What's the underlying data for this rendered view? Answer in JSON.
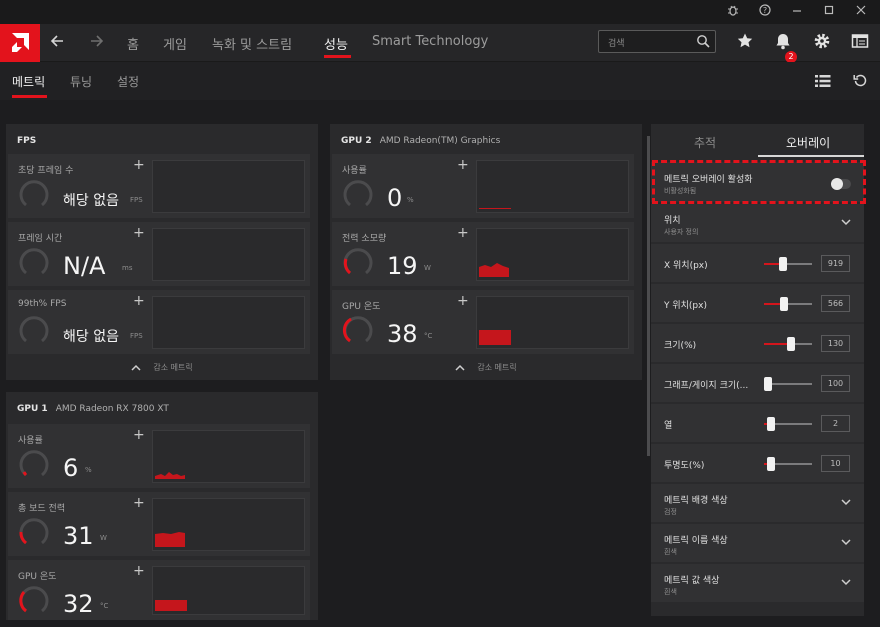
{
  "titlebar": {
    "icons": [
      "bug-icon",
      "help-icon",
      "minimize-icon",
      "maximize-icon",
      "close-icon"
    ]
  },
  "nav": {
    "items": [
      "홈",
      "게임",
      "녹화 및 스트림",
      "성능",
      "Smart Technology"
    ],
    "active": "성능",
    "search_placeholder": "검색",
    "notification_count": "2"
  },
  "subnav": {
    "items": [
      "메트릭",
      "튜닝",
      "설정"
    ],
    "active": "메트릭"
  },
  "colors": {
    "accent": "#e3131c",
    "bar": "#c5161c"
  },
  "cards": {
    "fps": {
      "title": "FPS",
      "metrics": [
        {
          "label": "초당 프레임 수",
          "value": "해당 없음",
          "unit": "FPS"
        },
        {
          "label": "프레임 시간",
          "value": "N/A",
          "unit": "ms"
        },
        {
          "label": "99th% FPS",
          "value": "해당 없음",
          "unit": "FPS"
        }
      ],
      "collapse_label": "감소 메트릭"
    },
    "gpu2": {
      "title": "GPU 2",
      "subtitle": "AMD Radeon(TM) Graphics",
      "metrics": [
        {
          "label": "사용률",
          "value": "0",
          "unit": "%"
        },
        {
          "label": "전력 소모량",
          "value": "19",
          "unit": "W"
        },
        {
          "label": "GPU 온도",
          "value": "38",
          "unit": "°C"
        }
      ],
      "collapse_label": "감소 메트릭"
    },
    "gpu1": {
      "title": "GPU 1",
      "subtitle": "AMD Radeon RX 7800 XT",
      "metrics": [
        {
          "label": "사용률",
          "value": "6",
          "unit": "%"
        },
        {
          "label": "총 보드 전력",
          "value": "31",
          "unit": "W"
        },
        {
          "label": "GPU 온도",
          "value": "32",
          "unit": "°C"
        }
      ]
    }
  },
  "overlay_panel": {
    "tabs": [
      "추적",
      "오버레이"
    ],
    "active_tab": "오버레이",
    "enable": {
      "label": "메트릭 오버레이 활성화",
      "status": "비활성화됨"
    },
    "position": {
      "label": "위치",
      "value": "사용자 정의"
    },
    "sliders": [
      {
        "label": "X 위치(px)",
        "value": "919"
      },
      {
        "label": "Y 위치(px)",
        "value": "566"
      },
      {
        "label": "크기(%)",
        "value": "130"
      },
      {
        "label": "그래프/게이지 크기(...",
        "value": "100"
      },
      {
        "label": "열",
        "value": "2"
      },
      {
        "label": "투명도(%)",
        "value": "10"
      }
    ],
    "colors": [
      {
        "label": "메트릭 배경 색상",
        "value": "검정"
      },
      {
        "label": "메트릭 이름 색상",
        "value": "흰색"
      },
      {
        "label": "메트릭 값 색상",
        "value": "흰색"
      }
    ]
  }
}
